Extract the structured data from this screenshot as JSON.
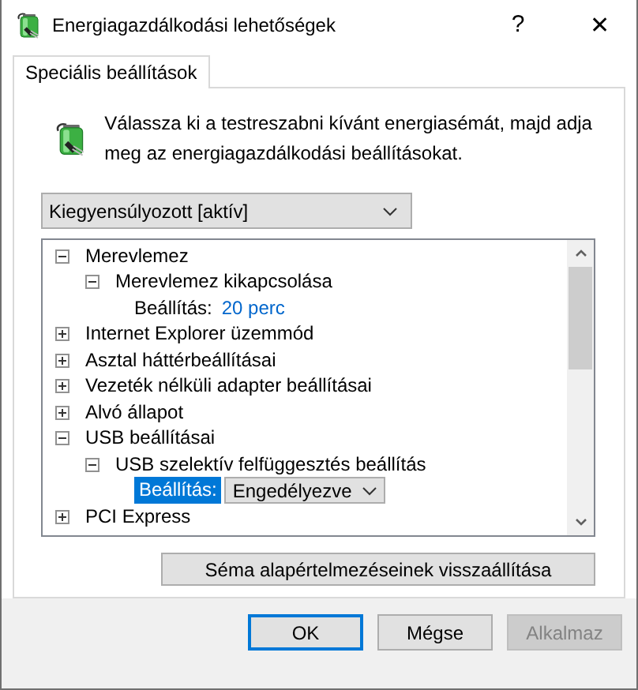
{
  "window": {
    "title": "Energiagazdálkodási lehetőségek",
    "help": "?",
    "close": "✕"
  },
  "tabs": [
    {
      "label": "Speciális beállítások",
      "selected": true
    }
  ],
  "description": "Válassza ki a testreszabni kívánt energiasémát, majd adja meg az energiagazdálkodási beállításokat.",
  "plan_dropdown": {
    "value": "Kiegyensúlyozott [aktív]"
  },
  "tree": [
    {
      "label": "Merevlemez",
      "expanded": true,
      "children": [
        {
          "label": "Merevlemez kikapcsolása",
          "expanded": true,
          "children": [
            {
              "kind": "setting",
              "label": "Beállítás:",
              "value": "20 perc",
              "selected": false
            }
          ]
        }
      ]
    },
    {
      "label": "Internet Explorer üzemmód",
      "expanded": false
    },
    {
      "label": "Asztal háttérbeállításai",
      "expanded": false
    },
    {
      "label": "Vezeték nélküli adapter beállításai",
      "expanded": false
    },
    {
      "label": "Alvó állapot",
      "expanded": false
    },
    {
      "label": "USB beállításai",
      "expanded": true,
      "children": [
        {
          "label": "USB szelektív felfüggesztés beállítás",
          "expanded": true,
          "children": [
            {
              "kind": "setting",
              "label": "Beállítás:",
              "value": "Engedélyezve",
              "selected": true
            }
          ]
        }
      ]
    },
    {
      "label": "PCI Express",
      "expanded": false
    }
  ],
  "reset_button": "Séma alapértelmezéseinek visszaállítása",
  "buttons": [
    {
      "label": "OK",
      "default": true,
      "disabled": false
    },
    {
      "label": "Mégse",
      "default": false,
      "disabled": false
    },
    {
      "label": "Alkalmaz",
      "default": false,
      "disabled": true
    }
  ]
}
